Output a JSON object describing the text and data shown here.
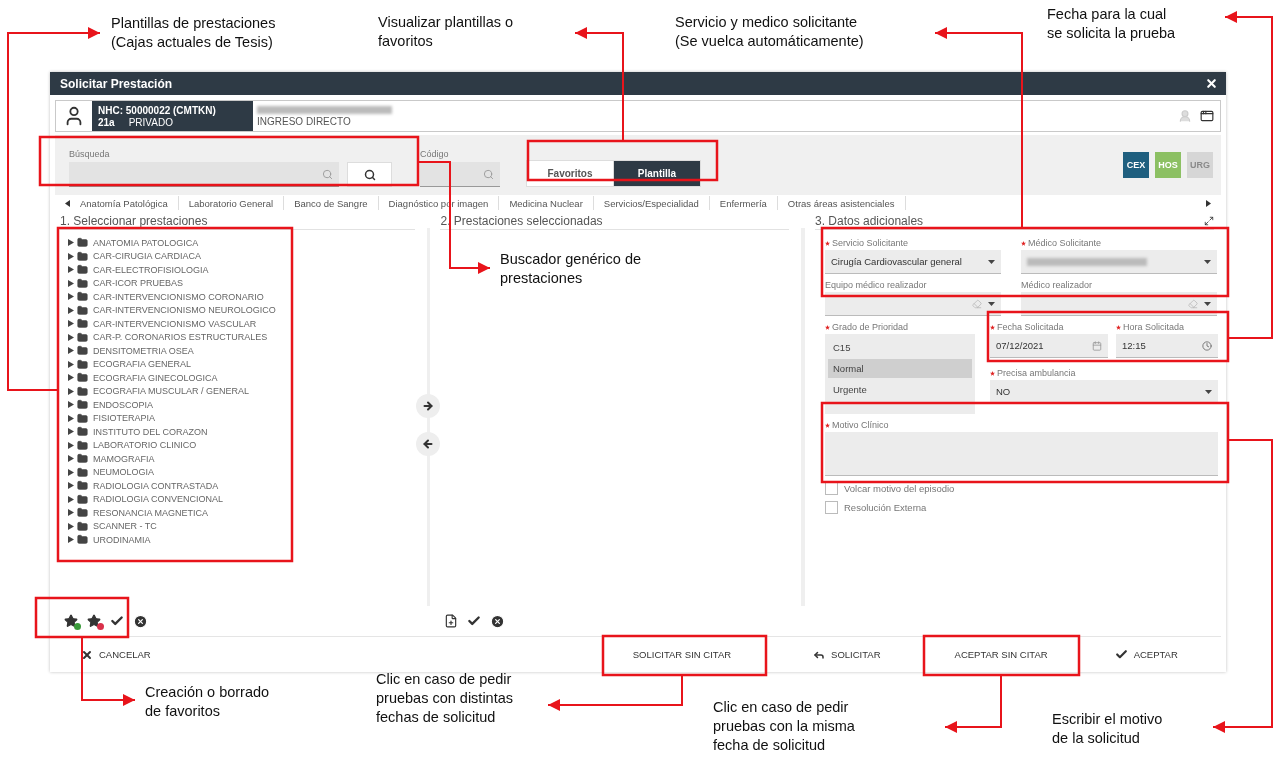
{
  "annotations": [
    {
      "text": "Plantillas de prestaciones\n(Cajas actuales de Tesis)"
    },
    {
      "text": "Visualizar plantillas o\nfavoritos"
    },
    {
      "text": "Servicio y medico solicitante\n(Se vuelca automáticamente)"
    },
    {
      "text": "Fecha para la cual\nse solicita la prueba"
    },
    {
      "text": "Buscador genérico de\nprestaciones"
    },
    {
      "text": "Creación o borrado\nde favoritos"
    },
    {
      "text": "Clic en caso de pedir\npruebas con distintas\nfechas de solicitud"
    },
    {
      "text": "Clic en caso de pedir\npruebas con la misma\nfecha de solicitud"
    },
    {
      "text": "Escribir el motivo\nde la solicitud"
    }
  ],
  "dialog": {
    "title": "Solicitar Prestación",
    "patient": {
      "nhc": "NHC: 50000022 (CMTKN)",
      "age": "21a",
      "insurance": "PRIVADO",
      "admission": "INGRESO DIRECTO"
    },
    "search": {
      "label": "Búsqueda"
    },
    "code": {
      "label": "Código"
    },
    "view_toggle": [
      {
        "label": "Favoritos",
        "selected": false
      },
      {
        "label": "Plantilla",
        "selected": true
      }
    ],
    "scopes": [
      {
        "label": "CEX",
        "color": "#1f5f7f",
        "disabled": false
      },
      {
        "label": "HOS",
        "color": "#8cc063",
        "disabled": false
      },
      {
        "label": "URG",
        "color": "#d6d6d6",
        "disabled": true
      }
    ],
    "categories": [
      "Anatomía Patológica",
      "Laboratorio General",
      "Banco de Sangre",
      "Diagnóstico por imagen",
      "Medicina Nuclear",
      "Servicios/Especialidad",
      "Enfermería",
      "Otras áreas asistenciales"
    ],
    "columns": [
      "1. Seleccionar prestaciones",
      "2. Prestaciones seleccionadas",
      "3. Datos adicionales"
    ],
    "tree": [
      {
        "label": "ANATOMIA PATOLOGICA",
        "expanded": false
      },
      {
        "label": "CAR-CIRUGIA CARDIACA",
        "expanded": false
      },
      {
        "label": "CAR-ELECTROFISIOLOGIA",
        "expanded": false
      },
      {
        "label": "CAR-ICOR PRUEBAS",
        "expanded": false
      },
      {
        "label": "CAR-INTERVENCIONISMO CORONARIO",
        "expanded": false
      },
      {
        "label": "CAR-INTERVENCIONISMO NEUROLOGICO",
        "expanded": false
      },
      {
        "label": "CAR-INTERVENCIONISMO VASCULAR",
        "expanded": false
      },
      {
        "label": "CAR-P. CORONARIOS ESTRUCTURALES",
        "expanded": false
      },
      {
        "label": "DENSITOMETRIA OSEA",
        "expanded": false
      },
      {
        "label": "ECOGRAFIA GENERAL",
        "expanded": false
      },
      {
        "label": "ECOGRAFIA GINECOLOGICA",
        "expanded": false
      },
      {
        "label": "ECOGRAFIA MUSCULAR / GENERAL",
        "expanded": false
      },
      {
        "label": "ENDOSCOPIA",
        "expanded": false
      },
      {
        "label": "FISIOTERAPIA",
        "expanded": false
      },
      {
        "label": "INSTITUTO DEL CORAZON",
        "expanded": false
      },
      {
        "label": "LABORATORIO CLINICO",
        "expanded": false
      },
      {
        "label": "MAMOGRAFIA",
        "expanded": false
      },
      {
        "label": "NEUMOLOGIA",
        "expanded": false
      },
      {
        "label": "RADIOLOGIA CONTRASTADA",
        "expanded": false
      },
      {
        "label": "RADIOLOGIA CONVENCIONAL",
        "expanded": false
      },
      {
        "label": "RESONANCIA MAGNETICA",
        "expanded": false
      },
      {
        "label": "SCANNER - TC",
        "expanded": false
      },
      {
        "label": "URODINAMIA",
        "expanded": false
      }
    ],
    "form": {
      "servicio_solicitante": {
        "label": "Servicio Solicitante",
        "value": "Cirugía Cardiovascular general",
        "required": true
      },
      "medico_solicitante": {
        "label": "Médico Solicitante",
        "required": true
      },
      "equipo_medico_realizador": {
        "label": "Equipo médico realizador",
        "required": false
      },
      "medico_realizador": {
        "label": "Médico realizador",
        "required": false
      },
      "grado_prioridad": {
        "label": "Grado de Prioridad",
        "required": true,
        "options": [
          {
            "label": "C15",
            "selected": false
          },
          {
            "label": "Normal",
            "selected": true
          },
          {
            "label": "Urgente",
            "selected": false
          }
        ]
      },
      "fecha_solicitada": {
        "label": "Fecha Solicitada",
        "value": "07/12/2021",
        "required": true
      },
      "hora_solicitada": {
        "label": "Hora Solicitada",
        "value": "12:15",
        "required": true
      },
      "precisa_ambulancia": {
        "label": "Precisa ambulancia",
        "value": "NO",
        "required": true
      },
      "motivo_clinico": {
        "label": "Motivo Clínico",
        "required": true
      },
      "checkboxes": [
        {
          "label": "Volcar motivo del episodio",
          "checked": false
        },
        {
          "label": "Resolución Externa",
          "checked": false
        }
      ]
    },
    "footer": [
      {
        "label": "CANCELAR",
        "kind": "cancel"
      },
      {
        "label": "SOLICITAR SIN CITAR",
        "kind": "plain"
      },
      {
        "label": "SOLICITAR",
        "kind": "request"
      },
      {
        "label": "ACEPTAR SIN CITAR",
        "kind": "plain"
      },
      {
        "label": "ACEPTAR",
        "kind": "accept"
      }
    ]
  }
}
